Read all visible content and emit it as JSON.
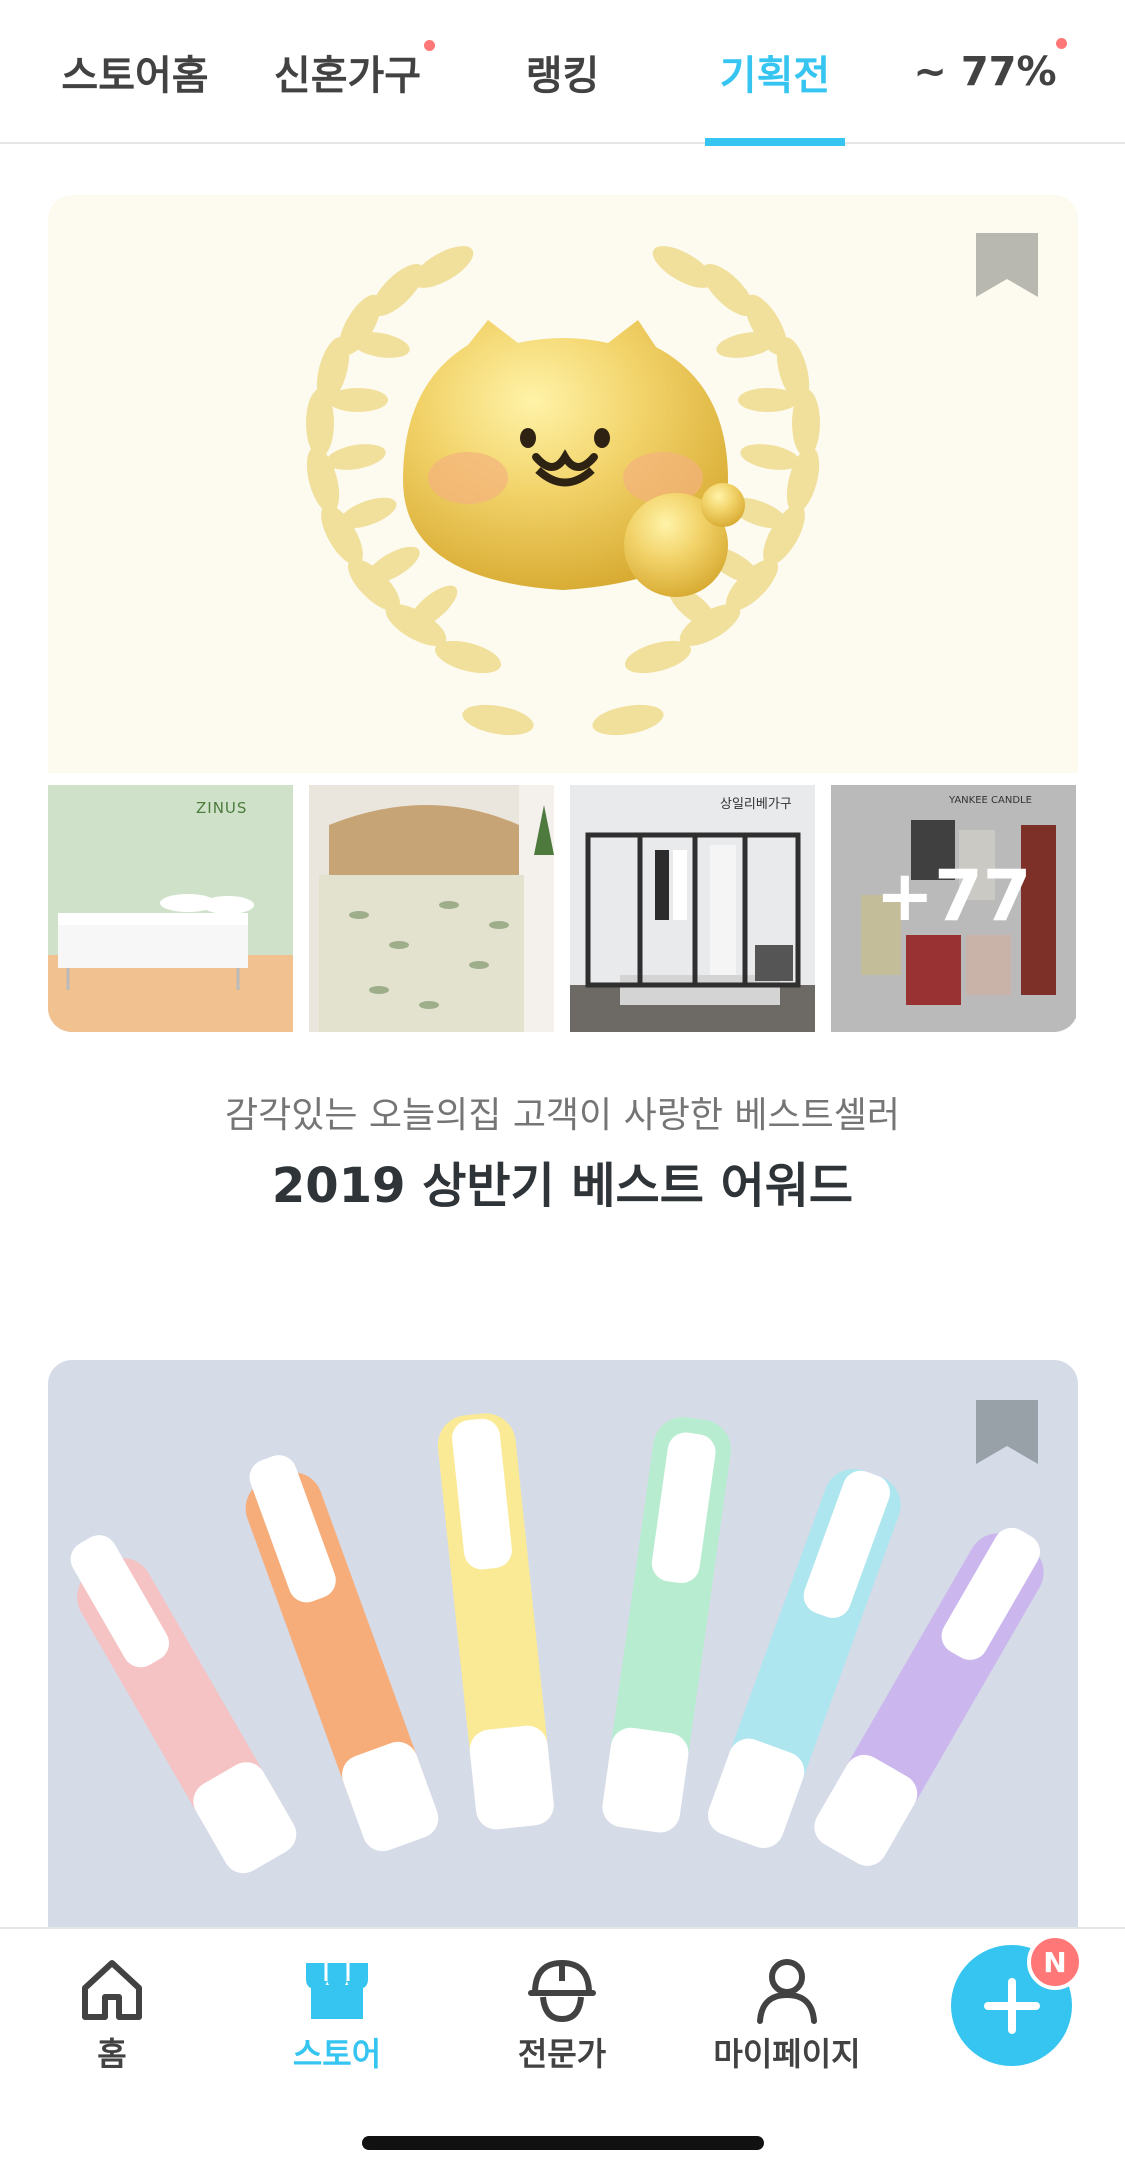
{
  "tabs": [
    {
      "label": "스토어홈",
      "active": false,
      "dot": false
    },
    {
      "label": "신혼가구",
      "active": false,
      "dot": true
    },
    {
      "label": "랭킹",
      "active": false,
      "dot": false
    },
    {
      "label": "기획전",
      "active": true,
      "dot": false
    },
    {
      "label": "~ 77%",
      "active": false,
      "dot": true
    }
  ],
  "feature": {
    "subtitle": "감각있는 오늘의집 고객이 사랑한 베스트셀러",
    "title": "2019 상반기 베스트 어워드",
    "more_count": "+77",
    "thumb_brands": [
      "ZINUS",
      "",
      "상일리베가구",
      "YANKEE CANDLE"
    ]
  },
  "bottom_nav": [
    {
      "label": "홈",
      "icon": "home-icon",
      "active": false
    },
    {
      "label": "스토어",
      "icon": "store-icon",
      "active": true
    },
    {
      "label": "전문가",
      "icon": "expert-helmet-icon",
      "active": false
    },
    {
      "label": "마이페이지",
      "icon": "person-icon",
      "active": false
    }
  ],
  "fab": {
    "icon": "plus-icon",
    "badge": "N"
  },
  "colors": {
    "accent": "#35c5f0",
    "dot": "#ff7777",
    "text": "#2f3438",
    "bookmark": "#b8b8b0"
  }
}
